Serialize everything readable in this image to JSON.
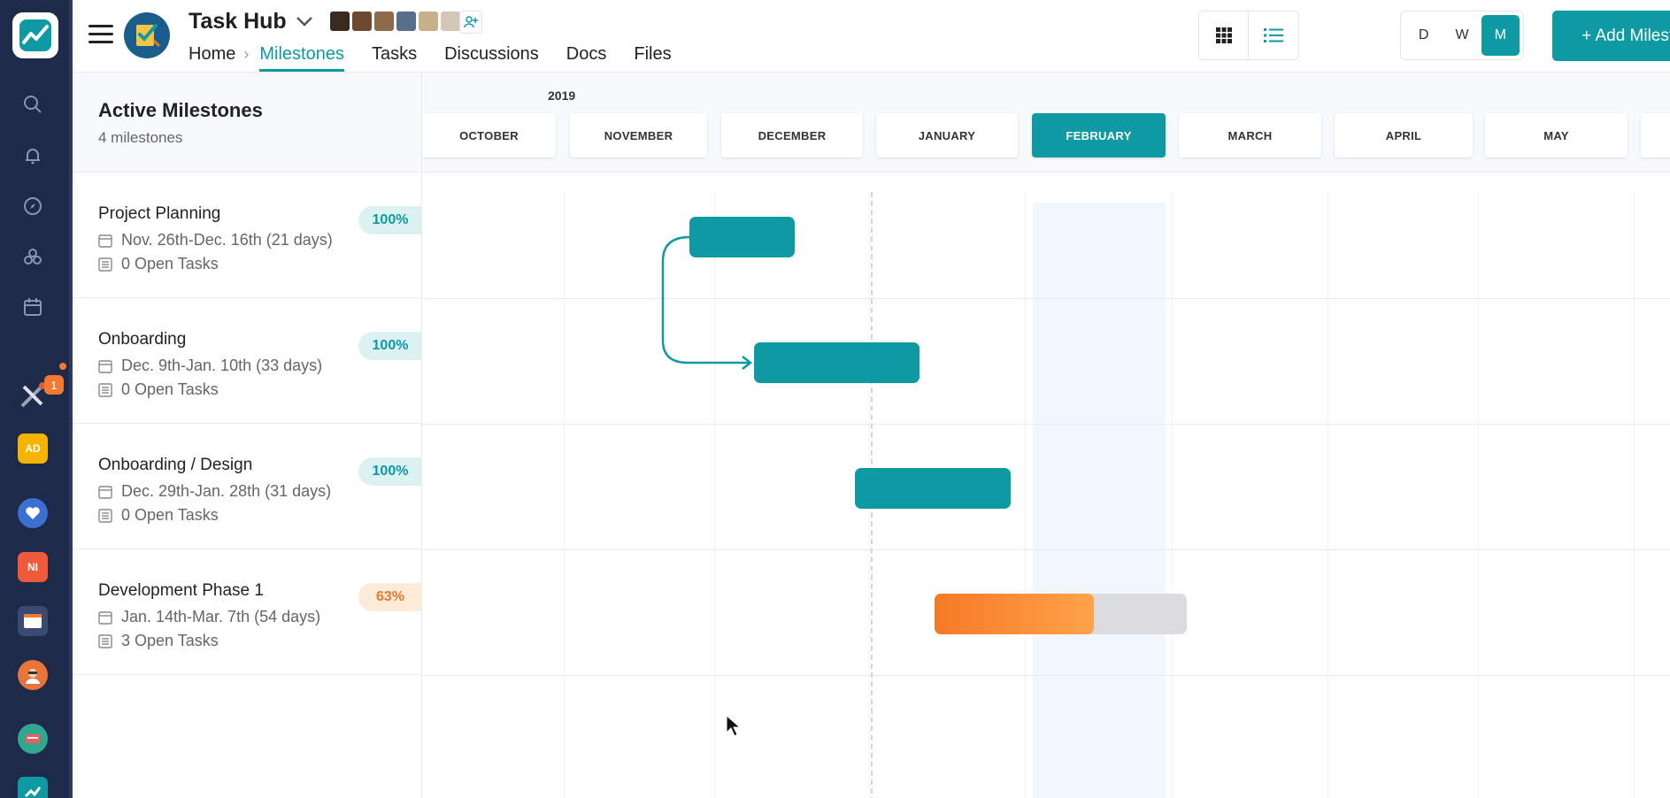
{
  "app": {
    "project_title": "Task Hub"
  },
  "nav": {
    "home": "Home",
    "milestones": "Milestones",
    "tasks": "Tasks",
    "discussions": "Discussions",
    "docs": "Docs",
    "files": "Files"
  },
  "toolbar": {
    "scale_day": "D",
    "scale_week": "W",
    "scale_month": "M",
    "add_milestone_label": "+ Add Milestone"
  },
  "sidebar": {
    "badge_count": "1",
    "app_ad": "AD",
    "app_ni": "NI"
  },
  "panel": {
    "title": "Active Milestones",
    "subtitle": "4 milestones"
  },
  "milestones": [
    {
      "name": "Project Planning",
      "dates": "Nov. 26th-Dec. 16th (21 days)",
      "tasks": "0 Open Tasks",
      "progress": "100%",
      "progress_value": 1.0
    },
    {
      "name": "Onboarding",
      "dates": "Dec. 9th-Jan. 10th (33 days)",
      "tasks": "0 Open Tasks",
      "progress": "100%",
      "progress_value": 1.0
    },
    {
      "name": "Onboarding / Design",
      "dates": "Dec. 29th-Jan. 28th (31 days)",
      "tasks": "0 Open Tasks",
      "progress": "100%",
      "progress_value": 1.0
    },
    {
      "name": "Development Phase 1",
      "dates": "Jan. 14th-Mar. 7th (54 days)",
      "tasks": "3 Open Tasks",
      "progress": "63%",
      "progress_value": 0.63
    }
  ],
  "timeline": {
    "year": "2019",
    "months": [
      "OCTOBER",
      "NOVEMBER",
      "DECEMBER",
      "JANUARY",
      "FEBRUARY",
      "MARCH",
      "APRIL",
      "MAY"
    ],
    "active_month": "FEBRUARY"
  },
  "colors": {
    "accent": "#0e9aa3",
    "rail": "#1e2a4a",
    "partial": "#f67a26"
  }
}
